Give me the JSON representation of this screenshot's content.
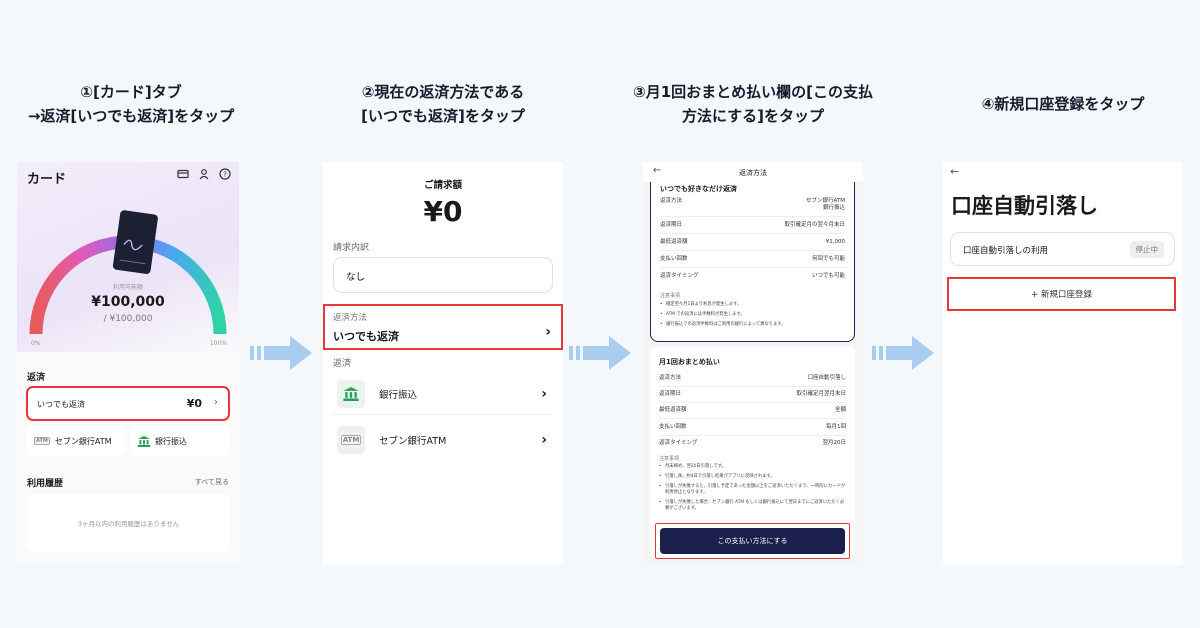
{
  "steps": [
    {
      "lines": [
        "①[カード]タブ",
        "→返済[いつでも返済]をタップ"
      ]
    },
    {
      "lines": [
        "②現在の返済方法である",
        "[いつでも返済]をタップ"
      ]
    },
    {
      "lines": [
        "③月1回おまとめ払い欄の[この支払",
        "方法にする]をタップ"
      ]
    },
    {
      "lines": [
        "④新規口座登録をタップ"
      ]
    }
  ],
  "screen1": {
    "title": "カード",
    "available_label": "利用可能額",
    "amount": "¥100,000",
    "limit": "/ ¥100,000",
    "gauge_min": "0%",
    "gauge_max": "100%",
    "repay_section": "返済",
    "repay_label": "いつでも返済",
    "repay_value": "¥0",
    "option_atm": "セブン銀行ATM",
    "option_bank": "銀行振込",
    "history_section": "利用履歴",
    "history_link": "すべて見る",
    "history_empty": "3ヶ月以内の利用履歴はありません"
  },
  "screen2": {
    "bill_label": "ご請求額",
    "bill_amount": "¥0",
    "detail_label": "請求内訳",
    "detail_value": "なし",
    "method_label": "返済方法",
    "method_value": "いつでも返済",
    "repay_label": "返済",
    "pay_options": [
      "銀行振込",
      "セブン銀行ATM"
    ]
  },
  "screen3": {
    "title": "返済方法",
    "card1": {
      "heading": "いつでも好きなだけ返済",
      "rows": [
        {
          "k": "返済方法",
          "v": "セブン銀行ATM\n銀行振込"
        },
        {
          "k": "返済期日",
          "v": "取引確定月の翌々月末日"
        },
        {
          "k": "最低返済額",
          "v": "¥1,000"
        },
        {
          "k": "支払い回数",
          "v": "何回でも可能"
        },
        {
          "k": "返済タイミング",
          "v": "いつでも可能"
        }
      ],
      "notes_label": "注意事項",
      "notes": [
        "確定翌々月1日より利息が発生します。",
        "ATM での返済には手数料が発生します。",
        "銀行振込での返済手数料はご利用の銀行によって異なります。"
      ]
    },
    "card2": {
      "heading": "月1回おまとめ払い",
      "rows": [
        {
          "k": "返済方法",
          "v": "口座自動引落し"
        },
        {
          "k": "返済期日",
          "v": "取引確定月翌月末日"
        },
        {
          "k": "最低返済額",
          "v": "全額"
        },
        {
          "k": "支払い回数",
          "v": "毎月1回"
        },
        {
          "k": "返済タイミング",
          "v": "翌月20日"
        }
      ],
      "notes_label": "注意事項",
      "notes": [
        "月末締め、翌20日引落しです。",
        "引落し後、約4日で引落し結果がアプリに反映されます。",
        "引落しが失敗すると、引落し予定であった金額以上をご返済いただくまで、一時的にカードが利用停止となります。",
        "引落しが失敗した場合、セブン銀行 ATM もしくは銀行振込にて翌日までにご返済いただく必要がございます。"
      ]
    },
    "button": "この支払い方法にする"
  },
  "screen4": {
    "title": "口座自動引落し",
    "use_label": "口座自動引落しの利用",
    "status": "停止中",
    "register": "+ 新規口座登録"
  }
}
